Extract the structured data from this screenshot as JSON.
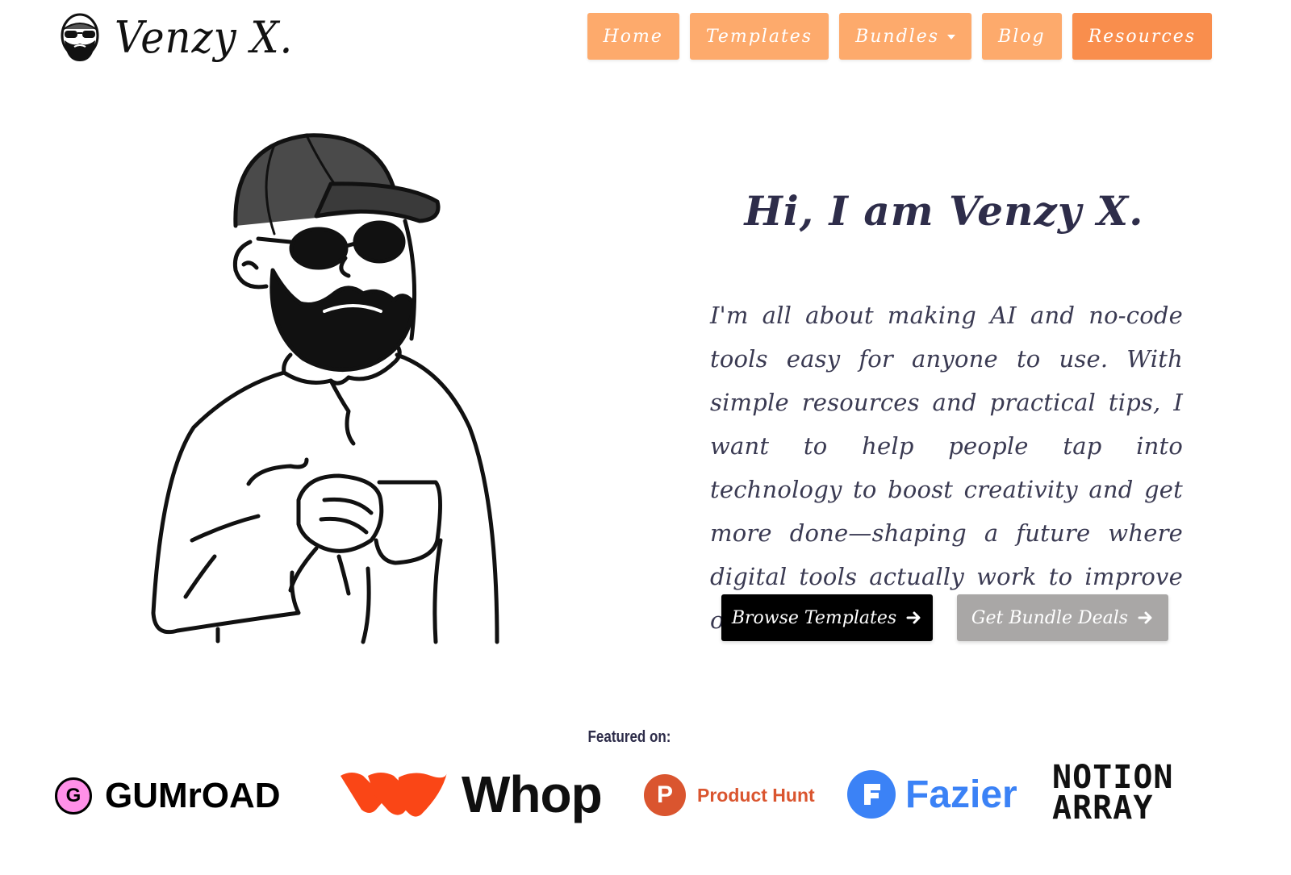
{
  "header": {
    "logo_text": "Venzy X.",
    "nav": [
      {
        "label": "Home"
      },
      {
        "label": "Templates"
      },
      {
        "label": "Bundles"
      },
      {
        "label": "Blog"
      },
      {
        "label": "Resources"
      }
    ]
  },
  "hero": {
    "title": "Hi, I am Venzy X.",
    "description": "I'm all about making AI and no-code tools easy for anyone to use. With simple resources and practical tips, I want to help people tap into technology to boost creativity and get more done—shaping a future where digital tools actually work to improve our lives.",
    "primary_cta": "Browse Templates",
    "secondary_cta": "Get Bundle Deals"
  },
  "featured": {
    "label": "Featured on:",
    "logos": [
      {
        "name": "gumroad",
        "mark": "G",
        "text": "GUMrOAD"
      },
      {
        "name": "whop",
        "text": "Whop"
      },
      {
        "name": "product-hunt",
        "mark": "P",
        "text": "Product Hunt"
      },
      {
        "name": "fazier",
        "text": "Fazier"
      },
      {
        "name": "notion-array",
        "line1": "NOTION",
        "line2": "ARRAY"
      }
    ]
  },
  "colors": {
    "nav_bg": "#fdaa6c",
    "nav_active": "#f98e4d",
    "primary_cta": "#000000",
    "secondary_cta": "#a9a7a6",
    "text": "#2e2d4a",
    "gumroad_pink": "#ff90e8",
    "whop_red": "#fa4616",
    "product_hunt": "#da552f",
    "fazier_blue": "#3b82f6"
  }
}
